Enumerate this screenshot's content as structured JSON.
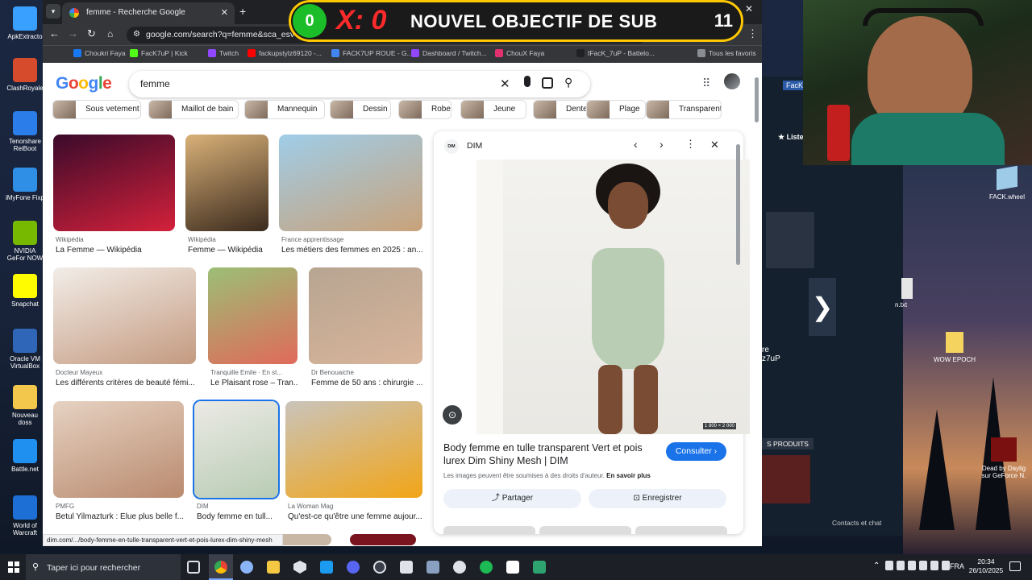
{
  "desktop": {
    "icons": [
      {
        "label": "ApkExtracto",
        "color": "#3aa0ff"
      },
      {
        "label": "ClashRoyale",
        "color": "#d64b2c"
      },
      {
        "label": "Tenorshare ReiBoot",
        "color": "#2b7de9"
      },
      {
        "label": "iMyFone Fixp",
        "color": "#2f8ee5"
      },
      {
        "label": "NVIDIA GeFor NOW",
        "color": "#76b900"
      },
      {
        "label": "Snapchat",
        "color": "#fffc00"
      },
      {
        "label": "Oracle VM VirtualBox",
        "color": "#2f66b8"
      },
      {
        "label": "Nouveau doss",
        "color": "#f3c74b"
      },
      {
        "label": "Battle.net",
        "color": "#1f8ff0"
      },
      {
        "label": "World of Warcraft",
        "color": "#1d6fd6"
      }
    ],
    "right_icons": [
      {
        "label": "FACK.wheel"
      },
      {
        "label": "WOW EPOCH"
      },
      {
        "label": "Dead by Daylig sur GeForce N."
      }
    ],
    "right_window_fragments": {
      "liste": "Liste",
      "fack": "FacK",
      "re": "re",
      "user": "z7uP",
      "produits": "S PRODUITS",
      "contacts": "Contacts et chat",
      "txt": "n.txt"
    }
  },
  "browser": {
    "tab_title": "femme - Recherche Google",
    "url": "google.com/search?q=femme&sca_esv=ea...1C...GR_frFR1104FR1104&udm=2&biw=1338&bih=695&sxsrf=AE3TifP3d...",
    "bookmarks": [
      {
        "label": "Choukri Faya",
        "color": "#1877f2"
      },
      {
        "label": "FacK7uP | Kick",
        "color": "#53fc18"
      },
      {
        "label": "Twitch",
        "color": "#9146ff"
      },
      {
        "label": "fackupstylz69120 -...",
        "color": "#ff0000"
      },
      {
        "label": "FACK7UP ROUE - G...",
        "color": "#4285f4"
      },
      {
        "label": "Dashboard / Twitch...",
        "color": "#9146ff"
      },
      {
        "label": "ChouX Faya",
        "color": "#e1306c"
      },
      {
        "label": "IFacK_7uP - Battelo...",
        "color": "#202124"
      },
      {
        "label": "Tous les favoris",
        "color": "#8a8d91"
      }
    ],
    "status_url": "dim.com/.../body-femme-en-tulle-transparent-vert-et-pois-lurex-dim-shiny-mesh"
  },
  "overlay": {
    "count": "0",
    "x_label": "X: 0",
    "title": "NOUVEL OBJECTIF DE SUB",
    "goal": "11"
  },
  "google": {
    "logo": "Google",
    "query": "femme",
    "chips": [
      "Sous vetement",
      "Maillot de bain",
      "Mannequin",
      "Dessin",
      "Robe",
      "Jeune",
      "Dentelle",
      "Plage",
      "Transparent"
    ],
    "results": [
      {
        "source": "Wikipédia",
        "title": "La Femme — Wikipédia",
        "colors": [
          "#3a0a2a",
          "#d4213b"
        ]
      },
      {
        "source": "Wikipédia",
        "title": "Femme — Wikipédia",
        "colors": [
          "#d9b178",
          "#3b2a1d"
        ]
      },
      {
        "source": "France apprentissage",
        "title": "Les métiers des femmes en 2025 : an...",
        "colors": [
          "#9fcde8",
          "#c9a27a"
        ]
      },
      {
        "source": "Docteur Mayeux",
        "title": "Les différents critères de beauté fémi...",
        "colors": [
          "#f2ede8",
          "#c49a80"
        ]
      },
      {
        "source": "Tranquille Emile · En st...",
        "title": "Le Plaisant rose – Tran...",
        "colors": [
          "#9bbf76",
          "#e06a5a"
        ]
      },
      {
        "source": "Dr Benouaiche",
        "title": "Femme de 50 ans : chirurgie ...",
        "colors": [
          "#b7a592",
          "#d8b49a"
        ]
      },
      {
        "source": "PMFG",
        "title": "Betul Yilmazturk : Élue plus belle f...",
        "colors": [
          "#e6d2c2",
          "#b98a6e"
        ]
      },
      {
        "source": "DIM",
        "title": "Body femme en tull...",
        "colors": [
          "#eceae5",
          "#b8ccb4"
        ]
      },
      {
        "source": "La Woman Mag",
        "title": "Qu'est-ce qu'être une femme aujour...",
        "colors": [
          "#c9c4bc",
          "#f2a516"
        ]
      }
    ],
    "panel": {
      "source": "DIM",
      "source_badge": "DIM",
      "image_size": "1 800 × 2 000",
      "title": "Body femme en tulle transparent Vert et pois lurex Dim Shiny Mesh | DIM",
      "copyright": "Les images peuvent être soumises à des droits d'auteur.",
      "learn_more": "En savoir plus",
      "visit_button": "Consulter",
      "share_button": "Partager",
      "save_button": "Enregistrer"
    }
  },
  "taskbar": {
    "search_placeholder": "Taper ici pour rechercher",
    "language": "FRA",
    "time": "20:34",
    "date": "26/10/2025"
  }
}
